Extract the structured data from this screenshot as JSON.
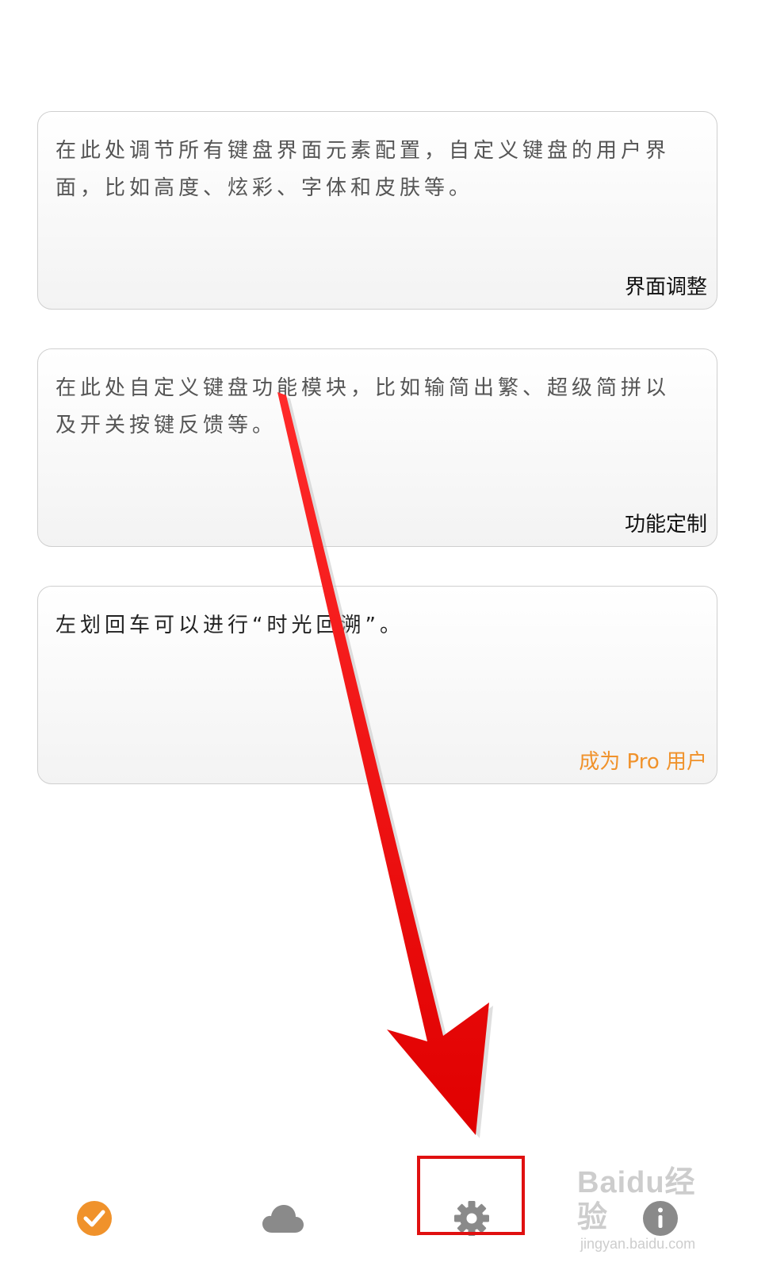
{
  "cards": [
    {
      "description": "在此处调节所有键盘界面元素配置，自定义键盘的用户界面，比如高度、炫彩、字体和皮肤等。",
      "action_label": "界面调整"
    },
    {
      "description": "在此处自定义键盘功能模块，比如输简出繁、超级简拼以及开关按键反馈等。",
      "action_label": "功能定制"
    },
    {
      "description": "左划回车可以进行“时光回溯”。",
      "action_label": "成为 Pro 用户"
    }
  ],
  "tabbar": {
    "tabs": [
      {
        "icon": "check-circle-icon"
      },
      {
        "icon": "cloud-icon"
      },
      {
        "icon": "gear-icon"
      },
      {
        "icon": "info-icon"
      }
    ]
  },
  "watermark": {
    "brand": "Baidu经验",
    "url": "jingyan.baidu.com"
  },
  "colors": {
    "accent": "#f0922b",
    "highlight": "#e01010",
    "icon_gray": "#8a8a8a"
  }
}
